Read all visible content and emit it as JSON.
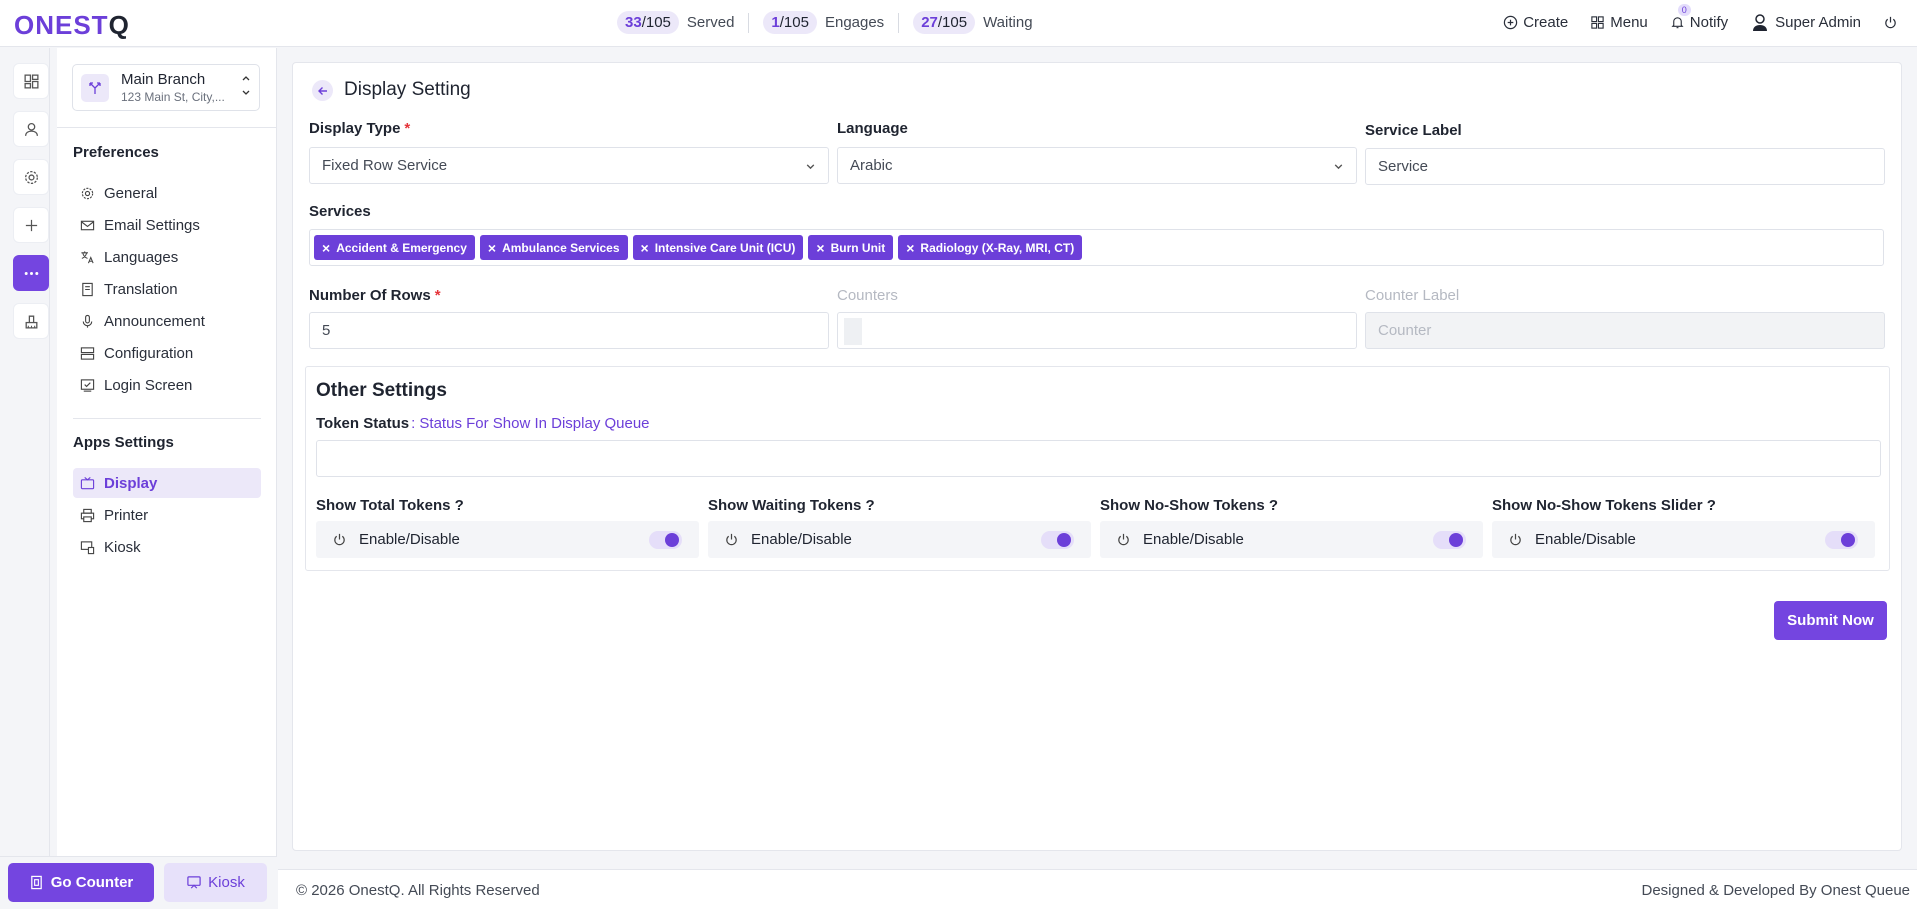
{
  "brand": {
    "logo_main": "ONEST",
    "logo_q": "Q",
    "accent": "#7445e0"
  },
  "stats": [
    {
      "count": "33",
      "total": "/105",
      "label": "Served"
    },
    {
      "count": "1",
      "total": "/105",
      "label": "Engages"
    },
    {
      "count": "27",
      "total": "/105",
      "label": "Waiting"
    }
  ],
  "header": {
    "create_label": "Create",
    "menu_label": "Menu",
    "notify_label": "Notify",
    "notify_count": "0",
    "user_name": "Super Admin"
  },
  "rail": {
    "icons": [
      "dashboard-icon",
      "user-icon",
      "gear-icon",
      "plus-icon",
      "more-icon",
      "printer-stack-icon"
    ]
  },
  "branch": {
    "name": "Main Branch",
    "address": "123 Main St, City,..."
  },
  "sidebar": {
    "preferences_heading": "Preferences",
    "preferences": [
      {
        "label": "General",
        "icon": "gear-icon"
      },
      {
        "label": "Email Settings",
        "icon": "mail-icon"
      },
      {
        "label": "Languages",
        "icon": "translate-icon"
      },
      {
        "label": "Translation",
        "icon": "book-icon"
      },
      {
        "label": "Announcement",
        "icon": "mic-icon"
      },
      {
        "label": "Configuration",
        "icon": "server-icon"
      },
      {
        "label": "Login Screen",
        "icon": "login-screen-icon"
      }
    ],
    "apps_heading": "Apps Settings",
    "apps": [
      {
        "label": "Display",
        "icon": "tv-icon",
        "active": true
      },
      {
        "label": "Printer",
        "icon": "printer-icon"
      },
      {
        "label": "Kiosk",
        "icon": "kiosk-icon"
      }
    ],
    "go_counter_label": "Go Counter",
    "kiosk_label": "Kiosk"
  },
  "form": {
    "title": "Display Setting",
    "display_type_label": "Display Type",
    "display_type_value": "Fixed Row Service",
    "language_label": "Language",
    "language_value": "Arabic",
    "service_label_label": "Service Label",
    "service_label_value": "Service",
    "services_label": "Services",
    "services": [
      "Accident & Emergency",
      "Ambulance Services",
      "Intensive Care Unit (ICU)",
      "Burn Unit",
      "Radiology (X-Ray, MRI, CT)"
    ],
    "rows_label": "Number Of Rows",
    "rows_value": "5",
    "counters_label": "Counters",
    "counter_label_label": "Counter Label",
    "counter_label_placeholder": "Counter",
    "required_mark": "*"
  },
  "other": {
    "title": "Other Settings",
    "token_status_label": "Token Status",
    "token_status_hint": ": Status For Show In Display Queue",
    "toggles": [
      {
        "label": "Show Total Tokens ?",
        "text": "Enable/Disable",
        "on": true
      },
      {
        "label": "Show Waiting Tokens ?",
        "text": "Enable/Disable",
        "on": true
      },
      {
        "label": "Show No-Show Tokens ?",
        "text": "Enable/Disable",
        "on": true
      },
      {
        "label": "Show No-Show Tokens Slider ?",
        "text": "Enable/Disable",
        "on": true
      }
    ],
    "submit_label": "Submit Now"
  },
  "footer": {
    "copyright": "© 2026 OnestQ. All Rights Reserved",
    "credit": "Designed & Developed By Onest Queue"
  }
}
